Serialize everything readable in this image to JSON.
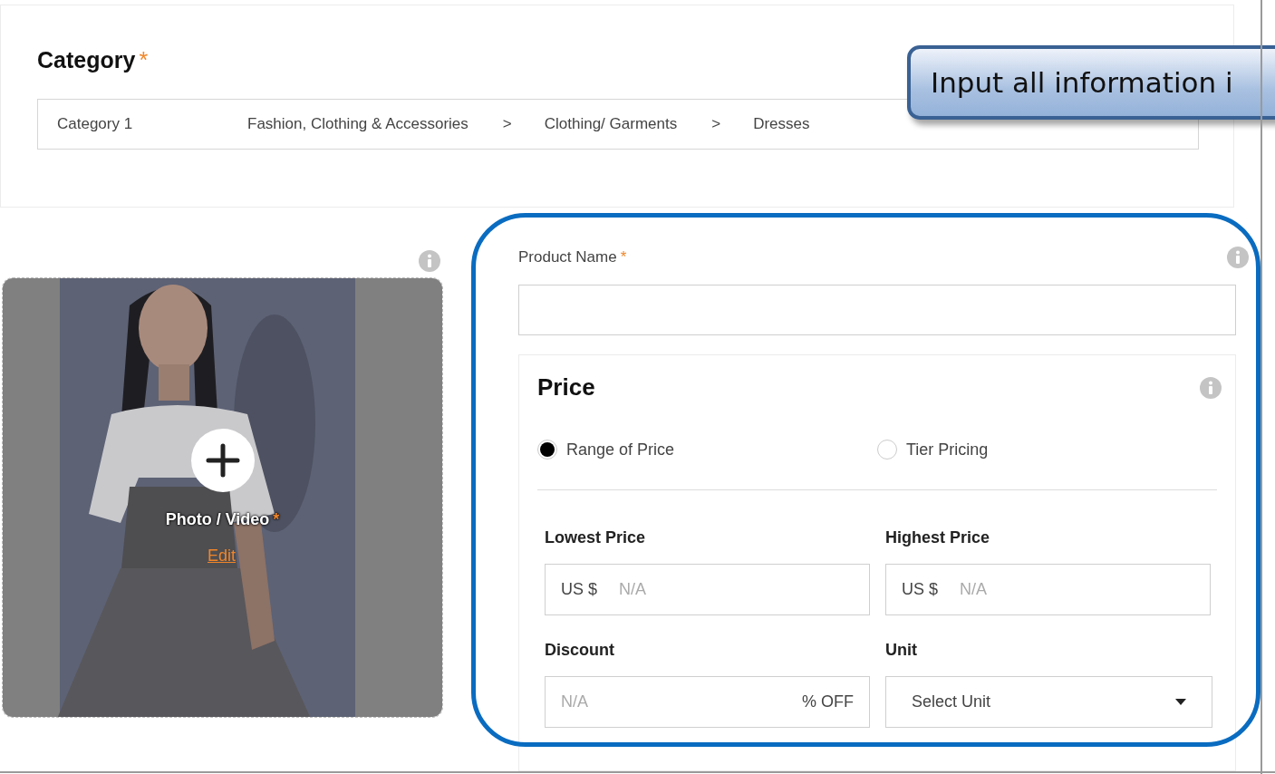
{
  "category": {
    "title": "Category",
    "required_mark": "*",
    "label": "Category 1",
    "path": [
      "Fashion, Clothing & Accessories",
      ">",
      "Clothing/ Garments",
      ">",
      "Dresses"
    ]
  },
  "callout": {
    "text": "Input all information i"
  },
  "media": {
    "label": "Photo / Video",
    "required_mark": "*",
    "link": "Edit"
  },
  "product_name": {
    "label": "Product Name",
    "required_mark": "*"
  },
  "price": {
    "title": "Price",
    "options": [
      {
        "label": "Range of Price",
        "selected": true
      },
      {
        "label": "Tier Pricing",
        "selected": false
      }
    ],
    "fields": [
      {
        "label": "Lowest Price",
        "kind": "currency",
        "prefix": "US $",
        "placeholder": "N/A"
      },
      {
        "label": "Highest Price",
        "kind": "currency",
        "prefix": "US $",
        "placeholder": "N/A"
      },
      {
        "label": "Discount",
        "kind": "percent",
        "placeholder": "N/A",
        "suffix": "% OFF"
      },
      {
        "label": "Unit",
        "kind": "select",
        "placeholder": "Select Unit"
      }
    ]
  }
}
